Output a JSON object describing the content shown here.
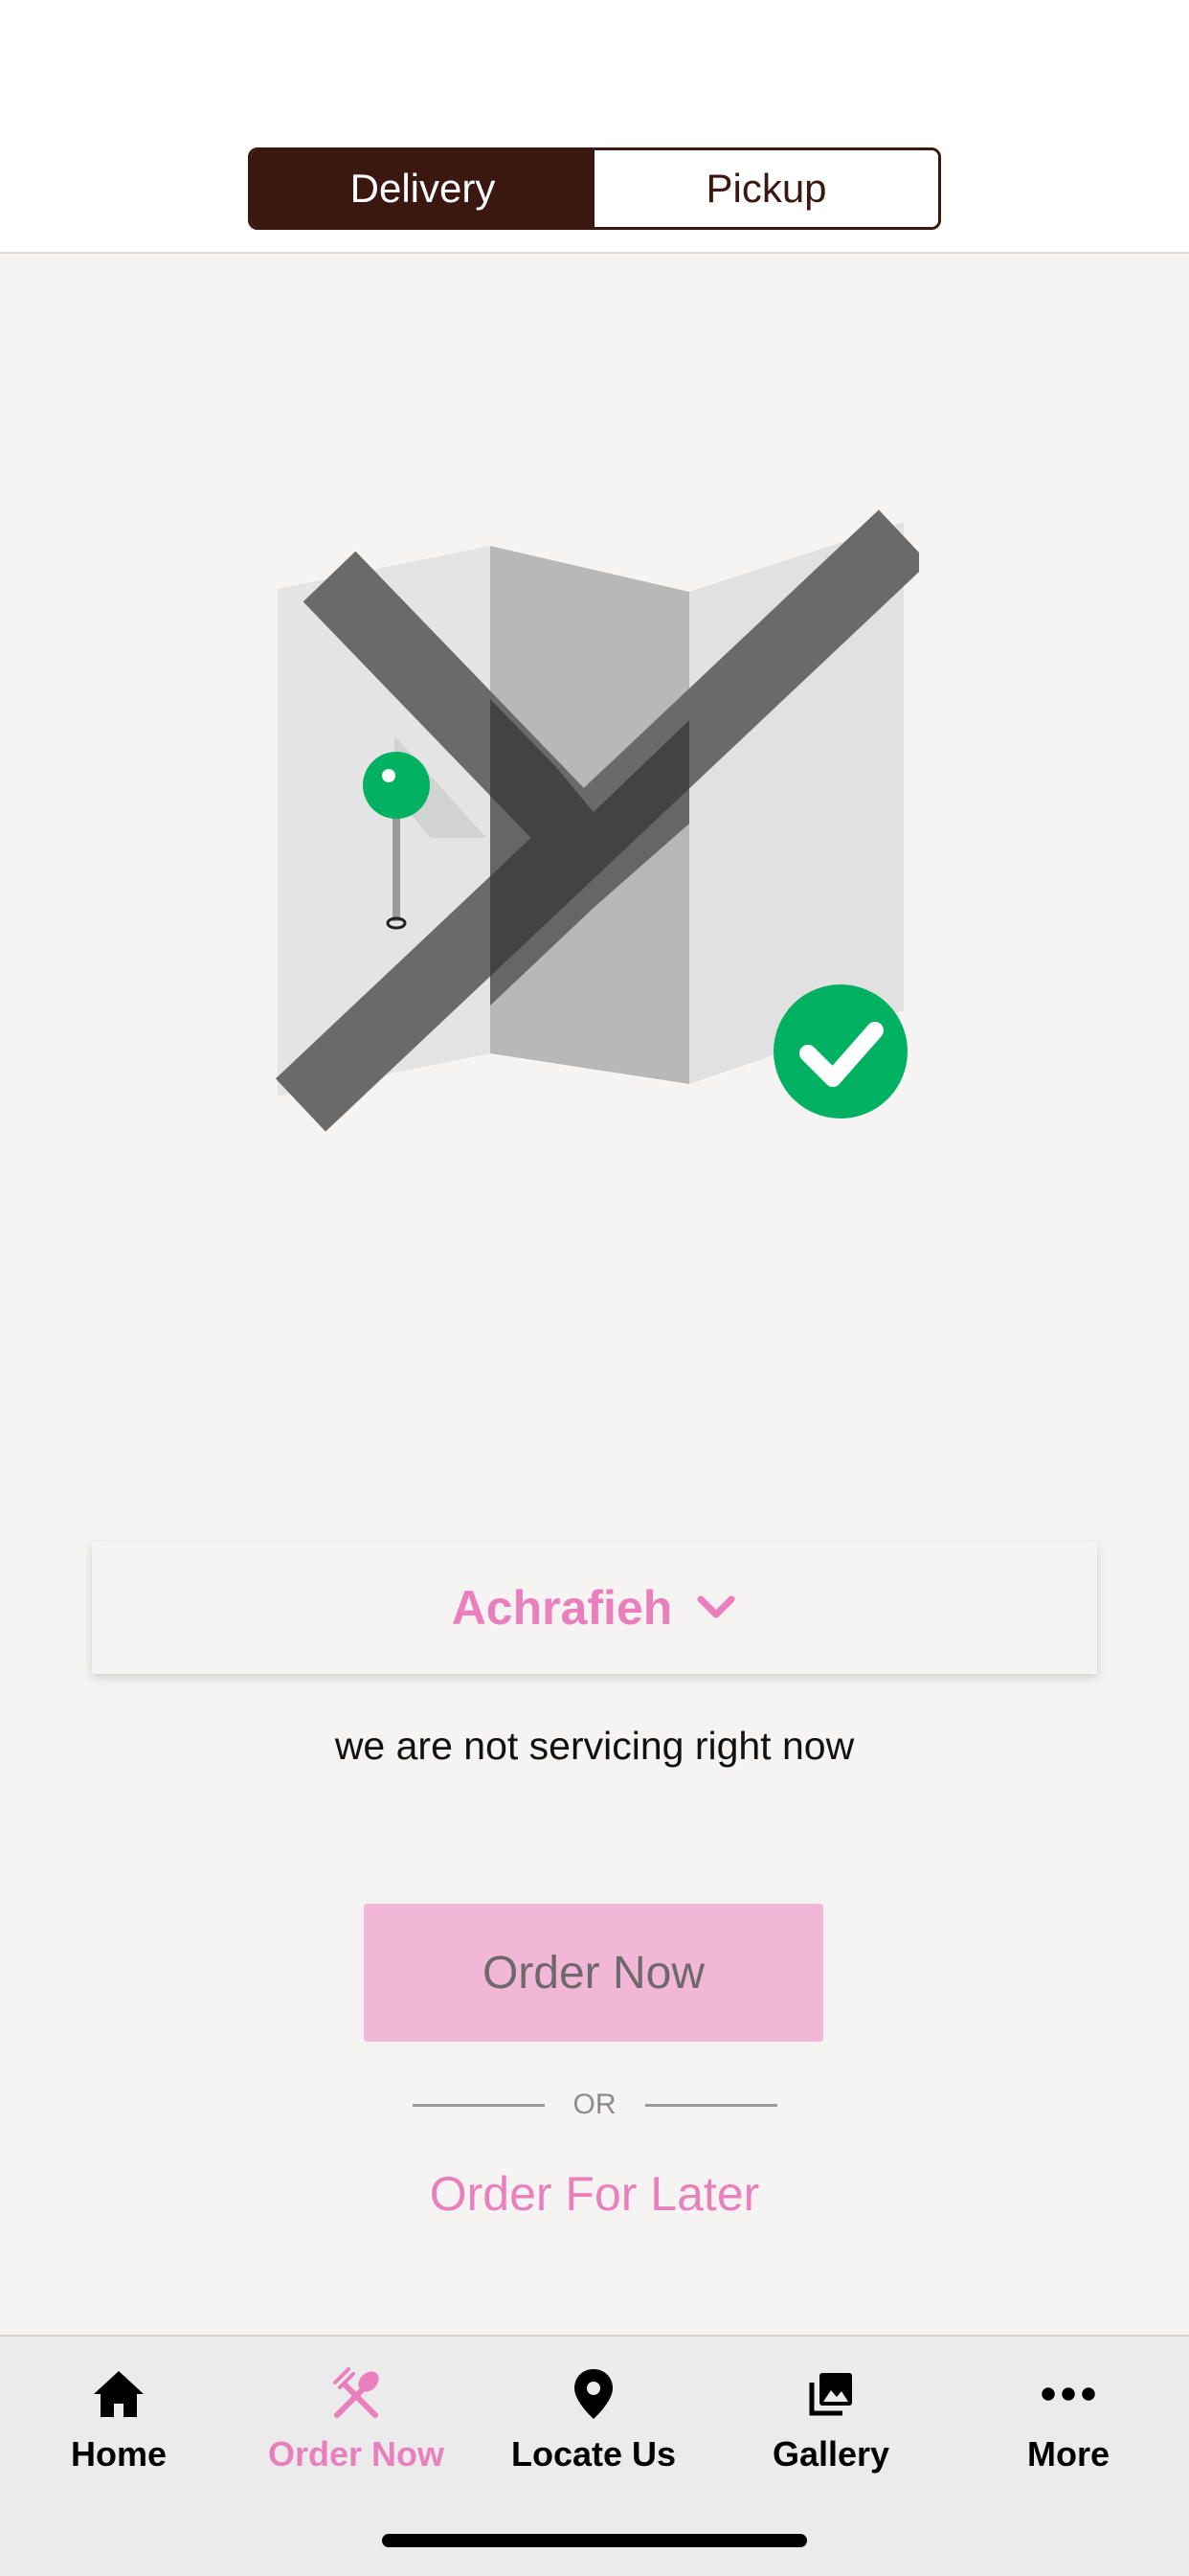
{
  "mode_toggle": {
    "delivery_label": "Delivery",
    "pickup_label": "Pickup",
    "selected": "Delivery"
  },
  "area_selector": {
    "value": "Achrafieh"
  },
  "status_message": "we are not servicing right now",
  "order_now_button": {
    "label": "Order Now"
  },
  "divider": {
    "label": "OR"
  },
  "order_later_link": {
    "label": "Order For Later"
  },
  "tabs": [
    {
      "label": "Home",
      "icon": "home-icon",
      "active": false
    },
    {
      "label": "Order Now",
      "icon": "cutlery-icon",
      "active": true
    },
    {
      "label": "Locate Us",
      "icon": "location-pin-icon",
      "active": false
    },
    {
      "label": "Gallery",
      "icon": "gallery-icon",
      "active": false
    },
    {
      "label": "More",
      "icon": "more-dots-icon",
      "active": false
    }
  ],
  "colors": {
    "brand_dark": "#3a1810",
    "accent_pink": "#e97fbd",
    "button_pink": "#f2b6d7",
    "success_green": "#00b162"
  }
}
